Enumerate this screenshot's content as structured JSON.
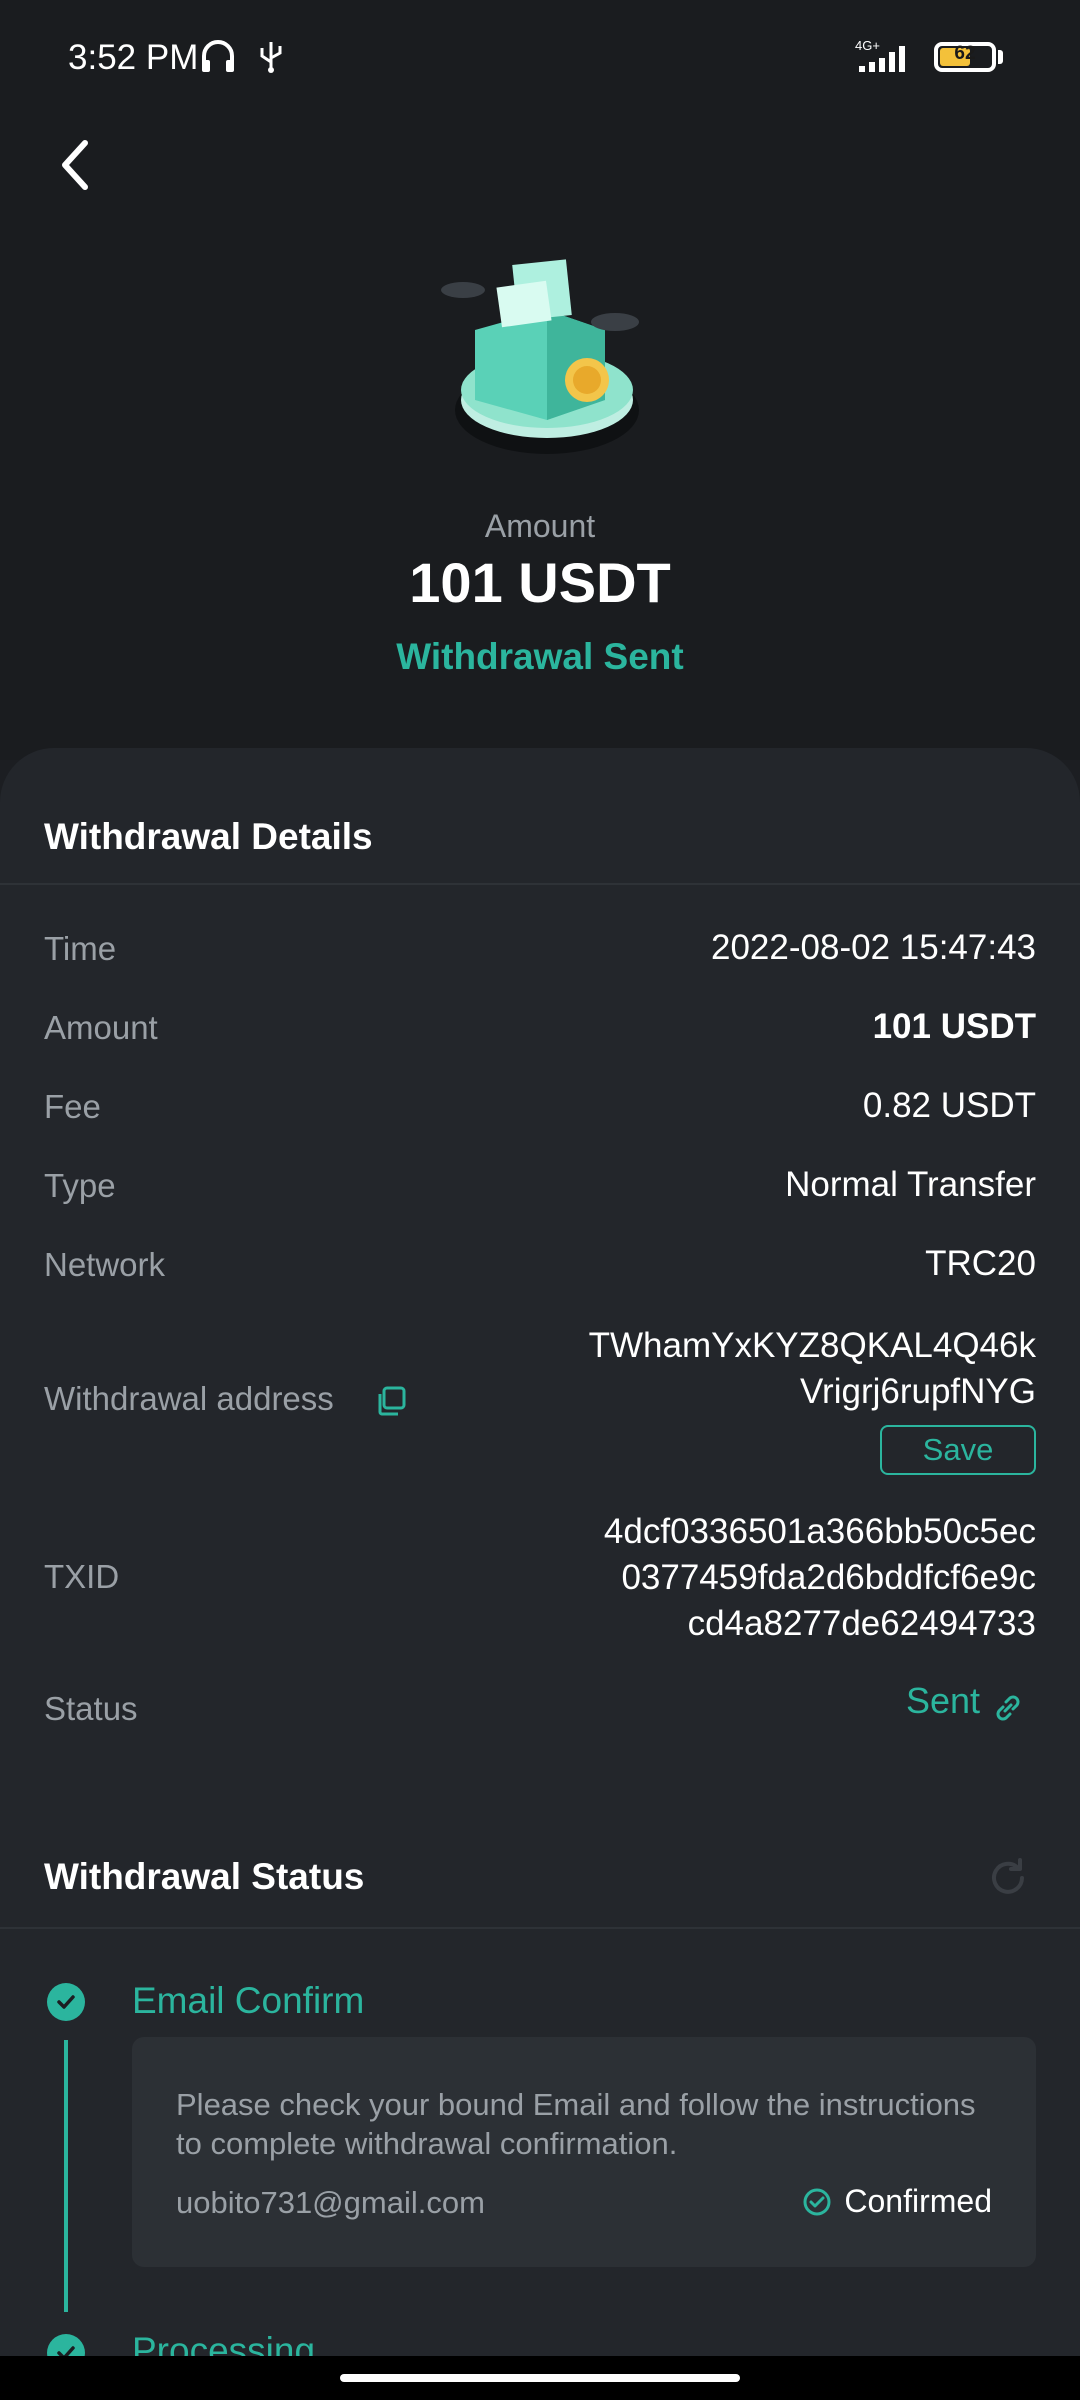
{
  "status_bar": {
    "time": "3:52 PM",
    "network": "4G+",
    "battery": "62",
    "icons": [
      "headphone-icon",
      "usb-icon",
      "signal-icon",
      "battery-icon"
    ]
  },
  "header": {
    "amount_label": "Amount",
    "amount_value": "101 USDT",
    "status": "Withdrawal Sent"
  },
  "details": {
    "title": "Withdrawal Details",
    "time_label": "Time",
    "time_value": "2022-08-02 15:47:43",
    "amount_label": "Amount",
    "amount_value": "101 USDT",
    "fee_label": "Fee",
    "fee_value": "0.82 USDT",
    "type_label": "Type",
    "type_value": "Normal Transfer",
    "network_label": "Network",
    "network_value": "TRC20",
    "address_label": "Withdrawal address",
    "address_line1": "TWhamYxKYZ8QKAL4Q46k",
    "address_line2": "Vrigrj6rupfNYG",
    "save_label": "Save",
    "txid_label": "TXID",
    "txid_line1": "4dcf0336501a366bb50c5ec",
    "txid_line2": "0377459fda2d6bddfcf6e9c",
    "txid_line3": "cd4a8277de62494733",
    "status_label": "Status",
    "status_value": "Sent"
  },
  "withdrawal_status": {
    "title": "Withdrawal Status",
    "steps": [
      {
        "title": "Email Confirm",
        "description": "Please check your bound Email and follow the instructions to complete withdrawal confirmation.",
        "email": "uobito731@gmail.com",
        "state": "Confirmed"
      },
      {
        "title": "Processing"
      }
    ]
  },
  "colors": {
    "accent": "#2bb59e",
    "background": "#1c1e22",
    "card": "#23262b",
    "muted_text": "#9aa0a6"
  }
}
